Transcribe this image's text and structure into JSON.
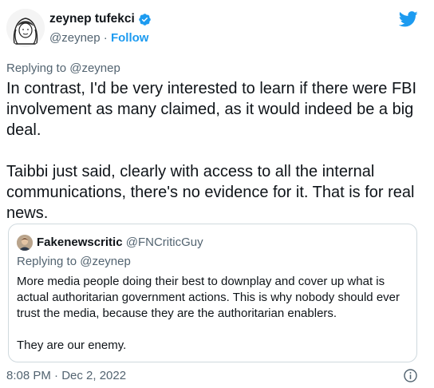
{
  "author": {
    "display_name": "zeynep tufekci",
    "handle": "@zeynep",
    "separator": " · ",
    "follow_label": "Follow"
  },
  "tweet": {
    "replying_to": "Replying to @zeynep",
    "text": "In contrast, I'd be very interested to learn if there were FBI involvement as many claimed, as it would indeed be a big deal.\n\nTaibbi just said, clearly with access to all the internal communications, there's no evidence for it. That is for real news.",
    "timestamp": "8:08 PM · Dec 2, 2022"
  },
  "quoted_tweet": {
    "display_name": "Fakenewscritic",
    "handle": "@FNCriticGuy",
    "replying_to": "Replying to @zeynep",
    "text": "More media people doing their best to downplay and cover up what is actual authoritarian government actions. This is why nobody should ever trust the media, because they are the authoritarian enablers.\n\nThey are our enemy."
  },
  "colors": {
    "accent": "#1d9bf0",
    "text": "#0f1419",
    "secondary_text": "#536471",
    "border": "#cfd9de"
  },
  "icons": {
    "verified": "verified-badge-icon",
    "brand": "twitter-bird-icon",
    "info": "info-icon"
  }
}
